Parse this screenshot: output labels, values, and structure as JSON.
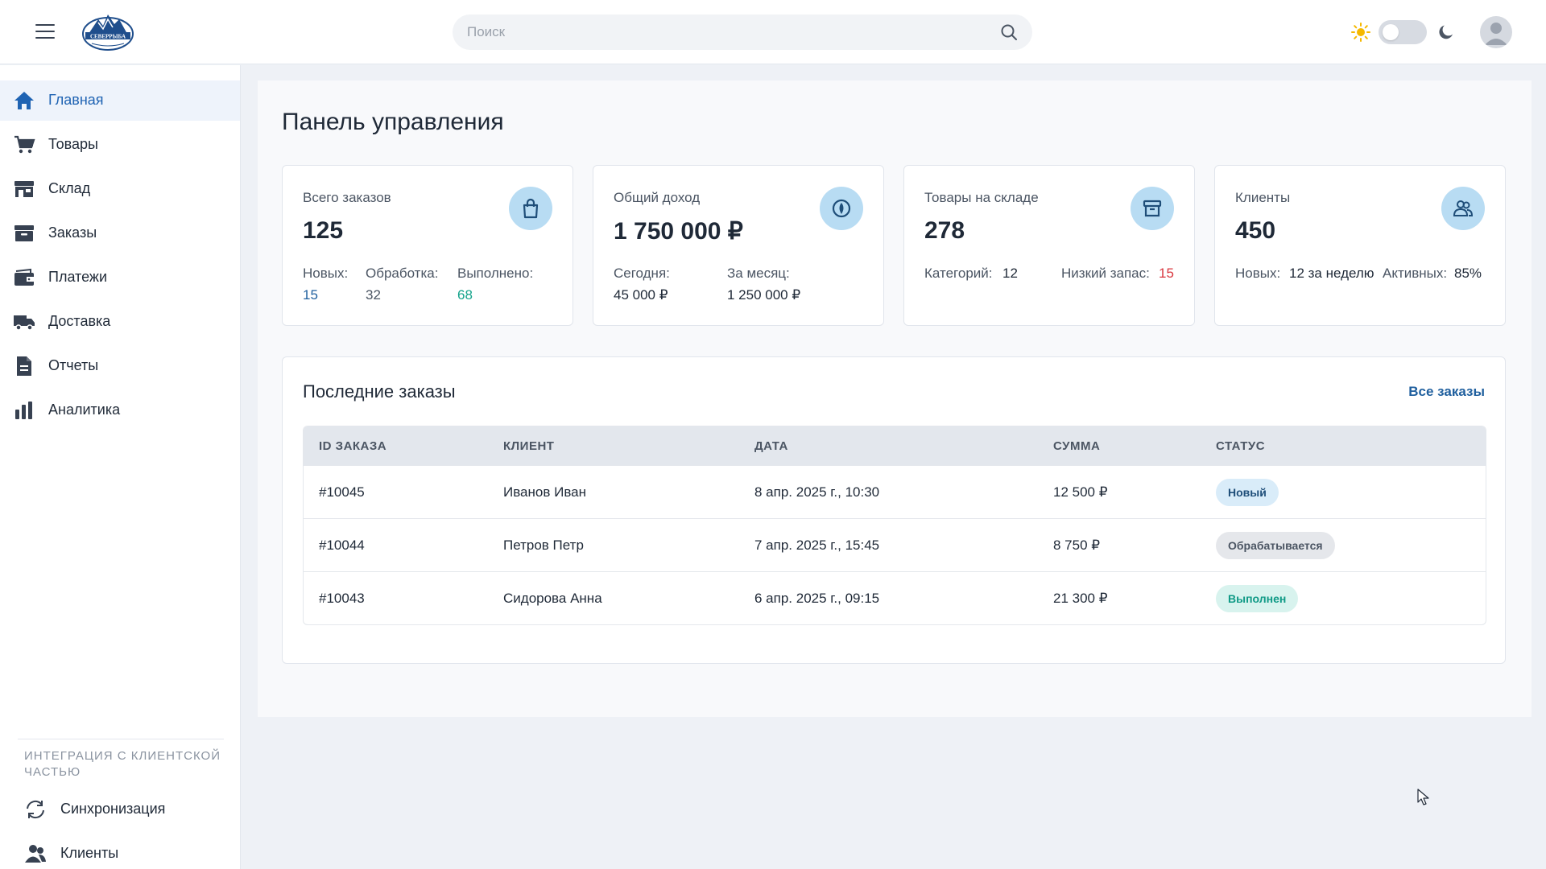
{
  "header": {
    "search_placeholder": "Поиск",
    "logo_text": "СЕВЕРРЫБА"
  },
  "sidebar": {
    "items": [
      {
        "label": "Главная",
        "icon": "home-icon",
        "active": true
      },
      {
        "label": "Товары",
        "icon": "cart-icon"
      },
      {
        "label": "Склад",
        "icon": "warehouse-icon"
      },
      {
        "label": "Заказы",
        "icon": "box-icon"
      },
      {
        "label": "Платежи",
        "icon": "wallet-icon"
      },
      {
        "label": "Доставка",
        "icon": "truck-icon"
      },
      {
        "label": "Отчеты",
        "icon": "document-icon"
      },
      {
        "label": "Аналитика",
        "icon": "bar-chart-icon"
      }
    ],
    "section_title": "Интеграция с клиентской частью",
    "section_items": [
      {
        "label": "Синхронизация",
        "icon": "sync-icon"
      },
      {
        "label": "Клиенты",
        "icon": "users-icon"
      }
    ]
  },
  "main": {
    "title": "Панель управления",
    "cards": {
      "orders": {
        "label": "Всего заказов",
        "value": "125",
        "icon": "shopping-bag-icon",
        "new_label": "Новых:",
        "new_value": "15",
        "proc_label": "Обработка:",
        "proc_value": "32",
        "done_label": "Выполнено:",
        "done_value": "68"
      },
      "income": {
        "label": "Общий доход",
        "value": "1 750 000 ₽",
        "icon": "coin-icon",
        "today_label": "Сегодня:",
        "today_value": "45 000 ₽",
        "month_label": "За месяц:",
        "month_value": "1 250 000 ₽"
      },
      "stock": {
        "label": "Товары на складе",
        "value": "278",
        "icon": "archive-icon",
        "cat_label": "Категорий:",
        "cat_value": "12",
        "low_label": "Низкий запас:",
        "low_value": "15"
      },
      "clients": {
        "label": "Клиенты",
        "value": "450",
        "icon": "users-icon",
        "new_label": "Новых:",
        "new_value": "12 за неделю",
        "active_label": "Активных:",
        "active_value": "85%"
      }
    },
    "orders_table": {
      "title": "Последние заказы",
      "all_link": "Все заказы",
      "headers": [
        "ID ЗАКАЗА",
        "КЛИЕНТ",
        "ДАТА",
        "СУММА",
        "СТАТУС"
      ],
      "rows": [
        {
          "id": "#10045",
          "client": "Иванов Иван",
          "date": "8 апр. 2025 г., 10:30",
          "sum": "12 500 ₽",
          "status": "Новый"
        },
        {
          "id": "#10044",
          "client": "Петров Петр",
          "date": "7 апр. 2025 г., 15:45",
          "sum": "8 750 ₽",
          "status": "Обрабатывается"
        },
        {
          "id": "#10043",
          "client": "Сидорова Анна",
          "date": "6 апр. 2025 г., 09:15",
          "sum": "21 300 ₽",
          "status": "Выполнен"
        }
      ]
    }
  },
  "colors": {
    "accent": "#1f63b3",
    "icon_bg": "#b8dcf3",
    "status_new": "#1f4e79",
    "status_done": "#0f9a86",
    "low_stock": "#d9373f",
    "done_count": "#14a38b"
  }
}
